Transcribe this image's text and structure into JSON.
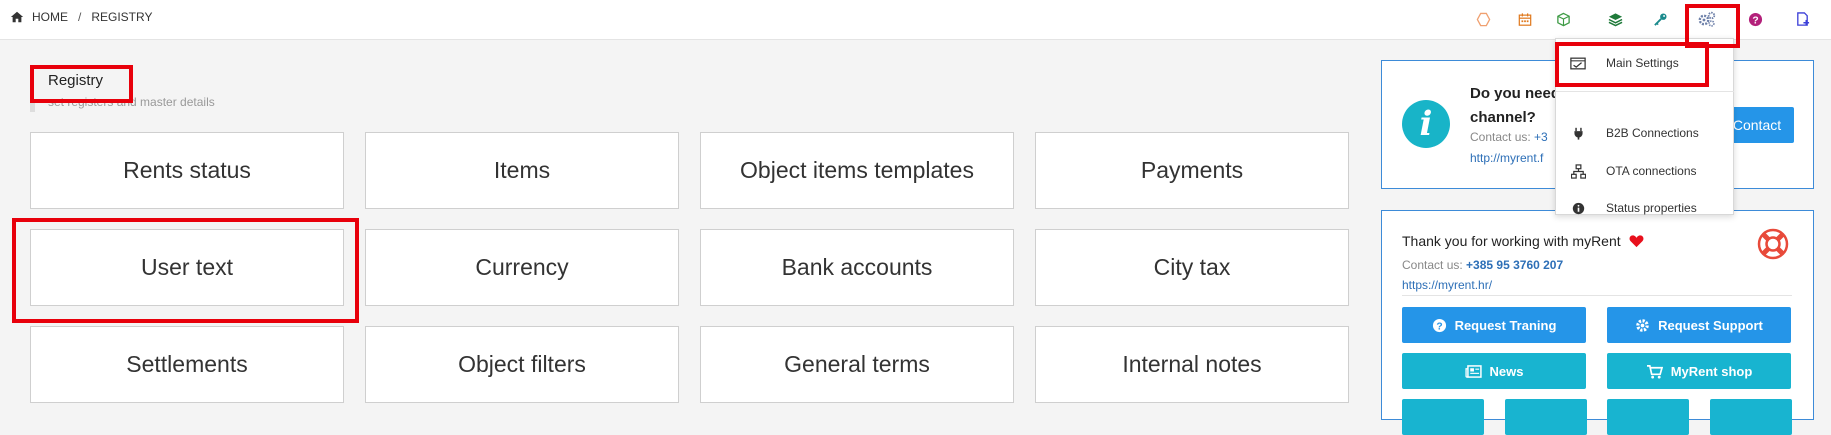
{
  "breadcrumb": {
    "home": "HOME",
    "separator": "/",
    "current": "REGISTRY"
  },
  "top_icons": [
    "hexagon-icon",
    "calendar-icon",
    "cube-icon",
    "layers-icon",
    "key-icon",
    "cogs-icon",
    "question-icon",
    "add-document-icon"
  ],
  "page": {
    "title": "Registry",
    "subtitle": "set registers and master details"
  },
  "tiles": [
    [
      "Rents status",
      "Items",
      "Object items templates",
      "Payments"
    ],
    [
      "User text",
      "Currency",
      "Bank accounts",
      "City tax"
    ],
    [
      "Settlements",
      "Object filters",
      "General terms",
      "Internal notes"
    ]
  ],
  "help_panel": {
    "title_line1": "Do you need",
    "title_line2": "channel?",
    "contact_label": "Contact us:",
    "contact_value": "+3",
    "link": "http://myrent.f",
    "button": "Contact"
  },
  "thanks_panel": {
    "title": "Thank you for working with myRent",
    "contact_label": "Contact us:",
    "phone": "+385 95 3760 207",
    "link": "https://myrent.hr/",
    "buttons": {
      "request_training": "Request Traning",
      "request_support": "Request Support",
      "news": "News",
      "shop": "MyRent shop"
    }
  },
  "dropdown": {
    "main_settings": "Main Settings",
    "b2b": "B2B Connections",
    "ota": "OTA connections",
    "status": "Status properties"
  },
  "colors": {
    "highlight": "#e8000b",
    "primary": "#2595e8",
    "accent": "#18b4d0"
  }
}
